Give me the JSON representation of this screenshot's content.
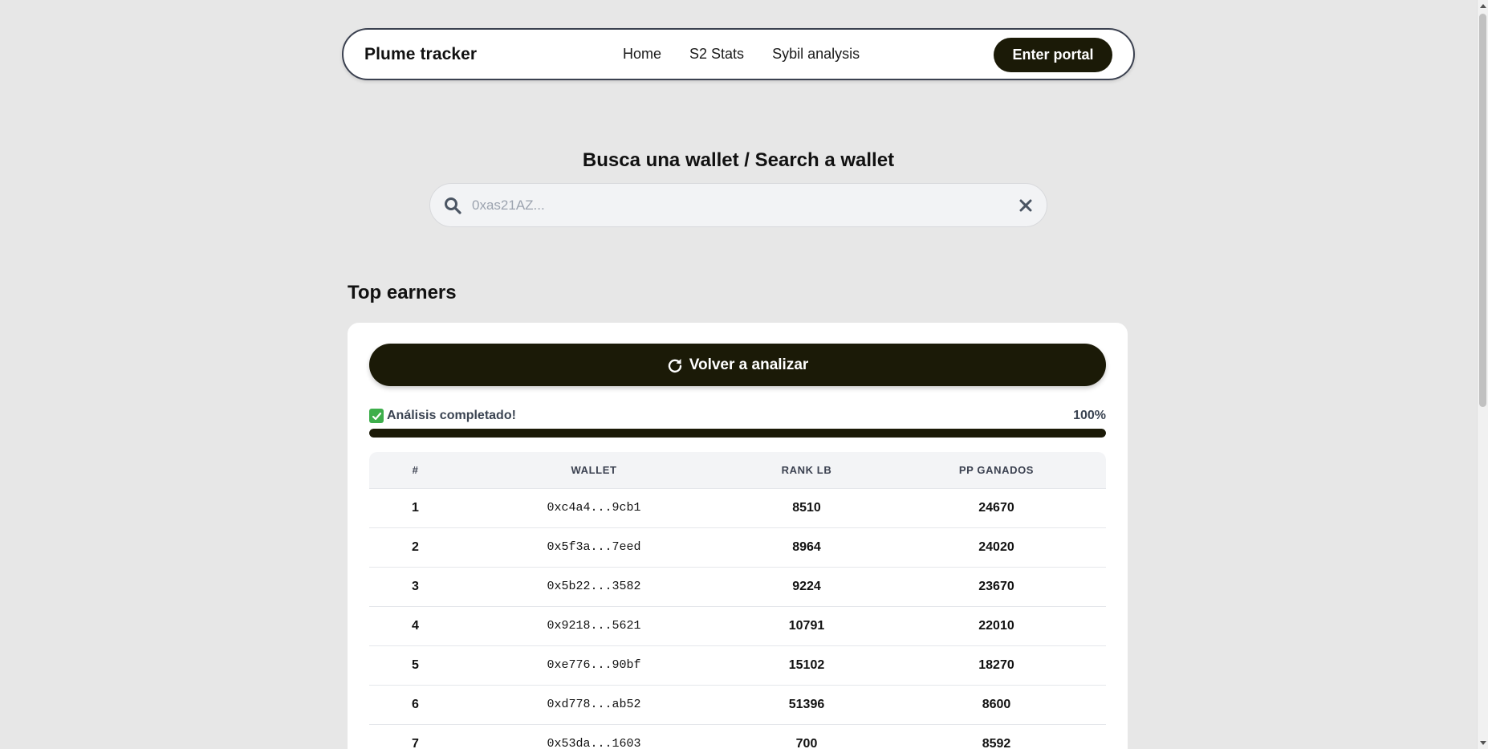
{
  "nav": {
    "brand": "Plume tracker",
    "links": [
      "Home",
      "S2 Stats",
      "Sybil analysis"
    ],
    "cta": "Enter portal"
  },
  "search": {
    "title": "Busca una wallet / Search a wallet",
    "placeholder": "0xas21AZ...",
    "value": ""
  },
  "top_earners": {
    "title": "Top earners",
    "reanalyze_label": "Volver a analizar",
    "status_text": "Análisis completado!",
    "progress_label": "100%",
    "progress_fraction": 1.0,
    "columns": [
      "#",
      "WALLET",
      "RANK LB",
      "PP GANADOS"
    ],
    "rows": [
      {
        "rank": "1",
        "wallet": "0xc4a4...9cb1",
        "rank_lb": "8510",
        "pp": "24670"
      },
      {
        "rank": "2",
        "wallet": "0x5f3a...7eed",
        "rank_lb": "8964",
        "pp": "24020"
      },
      {
        "rank": "3",
        "wallet": "0x5b22...3582",
        "rank_lb": "9224",
        "pp": "23670"
      },
      {
        "rank": "4",
        "wallet": "0x9218...5621",
        "rank_lb": "10791",
        "pp": "22010"
      },
      {
        "rank": "5",
        "wallet": "0xe776...90bf",
        "rank_lb": "15102",
        "pp": "18270"
      },
      {
        "rank": "6",
        "wallet": "0xd778...ab52",
        "rank_lb": "51396",
        "pp": "8600"
      },
      {
        "rank": "7",
        "wallet": "0x53da...1603",
        "rank_lb": "700",
        "pp": "8592"
      }
    ]
  },
  "icons": {
    "search": "search-icon",
    "clear": "close-icon",
    "refresh": "refresh-icon",
    "check": "check-icon"
  },
  "colors": {
    "page_bg": "#e7e7e7",
    "dark_accent": "#1b1a07",
    "check_green": "#3dae4b"
  }
}
